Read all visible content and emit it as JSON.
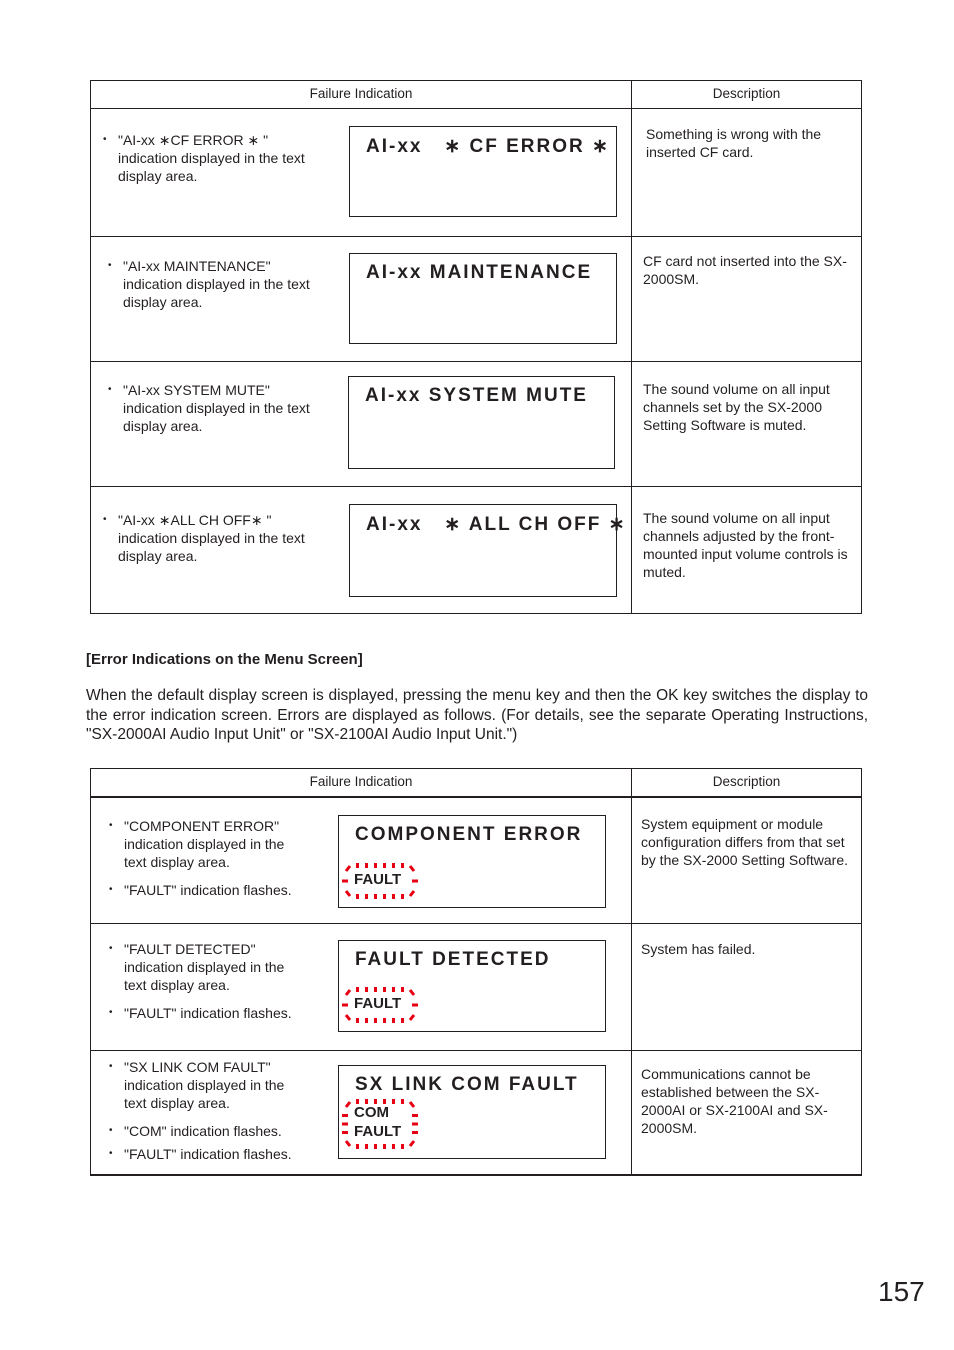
{
  "table1": {
    "headers": [
      "Failure Indication",
      "Description"
    ],
    "rows": [
      {
        "bullets": [
          "\"AI-xx  ∗CF ERROR ∗ \" indication displayed in the text display area."
        ],
        "display_text": "AI-xx   ∗ CF ERROR ∗",
        "description": "Something is wrong with the inserted CF card."
      },
      {
        "bullets": [
          "\"AI-xx MAINTENANCE\" indication displayed in the text display area."
        ],
        "display_text": "AI-xx MAINTENANCE",
        "description": "CF card not inserted into the SX-2000SM."
      },
      {
        "bullets": [
          "\"AI-xx SYSTEM MUTE\" indication displayed in the text display area."
        ],
        "display_text": "AI-xx SYSTEM MUTE",
        "description": "The sound volume on all input channels set by the SX-2000 Setting Software is muted."
      },
      {
        "bullets": [
          "\"AI-xx  ∗ALL CH OFF∗  \" indication displayed in the text display area."
        ],
        "display_text": "AI-xx   ∗ ALL CH OFF ∗",
        "description": "The sound volume on all input channels adjusted by the front-mounted input volume controls is muted."
      }
    ]
  },
  "section": {
    "title": "[Error Indications on the Menu Screen]",
    "paragraph": "When the default display screen is displayed, pressing the menu key and then the OK key switches the display to the error indication screen. Errors are displayed as follows. (For details, see the separate Operating Instructions, \"SX-2000AI Audio Input Unit\" or \"SX-2100AI Audio Input Unit.\")"
  },
  "table2": {
    "headers": [
      "Failure Indication",
      "Description"
    ],
    "rows": [
      {
        "bullets": [
          "\"COMPONENT ERROR\" indication displayed in the text display area.",
          "\"FAULT\" indication flashes."
        ],
        "display_text": "COMPONENT ERROR",
        "indicators": [
          "FAULT"
        ],
        "description": "System equipment or module configuration differs from that set by the SX-2000 Setting Software."
      },
      {
        "bullets": [
          "\"FAULT DETECTED\" indication displayed in the text display area.",
          "\"FAULT\" indication flashes."
        ],
        "display_text": "FAULT DETECTED",
        "indicators": [
          "FAULT"
        ],
        "description": "System has failed."
      },
      {
        "bullets": [
          "\"SX LINK COM FAULT\" indication displayed in the text display area.",
          "\"COM\" indication flashes.",
          "\"FAULT\" indication flashes."
        ],
        "display_text": "SX LINK COM FAULT",
        "indicators": [
          "COM",
          "FAULT"
        ],
        "description": "Communications cannot be established between the SX-2000AI or SX-2100AI and SX-2000SM."
      }
    ]
  },
  "colors": {
    "text": "#231f20",
    "flash_marks": "#e60012"
  },
  "page_number": "157"
}
